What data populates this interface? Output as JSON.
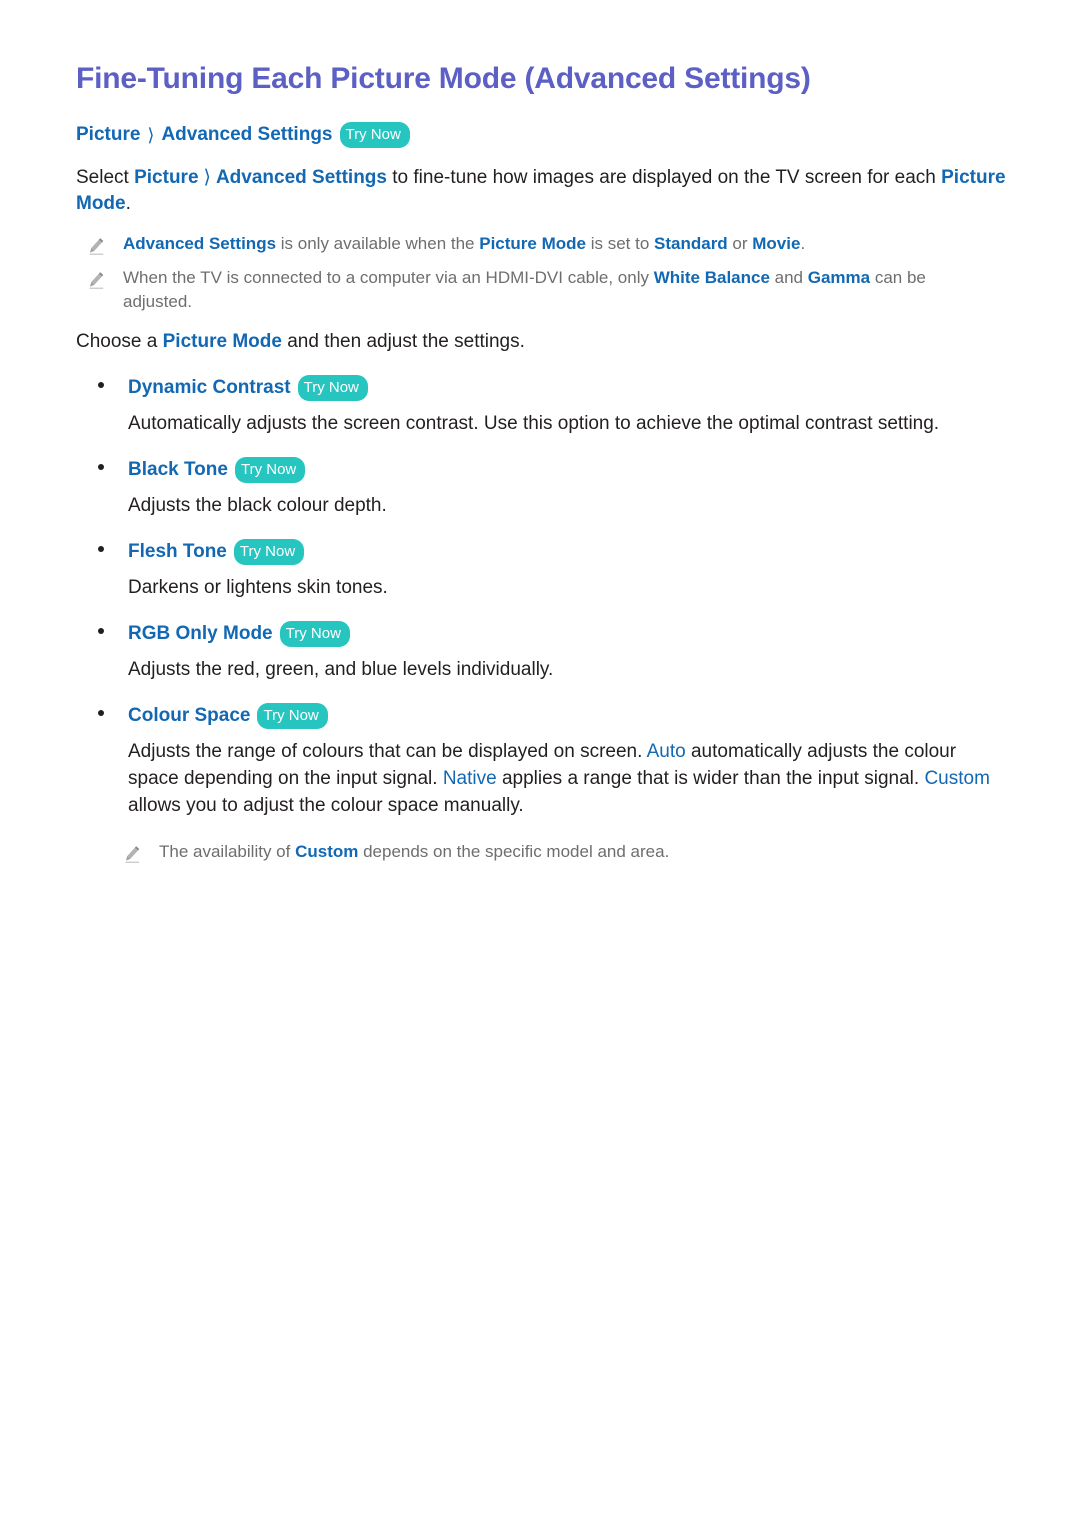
{
  "document": {
    "title": "Fine-Tuning Each Picture Mode (Advanced Settings)"
  },
  "labels": {
    "try_now": "Try Now",
    "caret": "❯"
  },
  "colors": {
    "heading": "#5C5FC4",
    "link_blue": "#1268B3",
    "badge_teal": "#27C5C0",
    "body_text": "#231F20",
    "note_text": "#6D6E70"
  },
  "path": {
    "segment_1": "Picture",
    "segment_2": "Advanced Settings"
  },
  "intro": {
    "lead": "Select ",
    "link_1": "Picture",
    "link_2": "Advanced Settings",
    "middle": " to fine-tune how images are displayed on the TV screen for each ",
    "link_3": "Picture Mode",
    "end": "."
  },
  "notes_top": [
    {
      "icon": "pencil-icon",
      "part_1": "Advanced Settings",
      "part_2": " is only available when the ",
      "part_3": "Picture Mode",
      "part_4": " is set to ",
      "part_5": "Standard",
      "part_6": " or ",
      "part_7": "Movie",
      "part_8": "."
    },
    {
      "icon": "pencil-icon",
      "part_1": "When the TV is connected to a computer via an HDMI-DVI cable, only ",
      "part_2": "White Balance",
      "part_3": " and ",
      "part_4": "Gamma",
      "part_5": " can be adjusted."
    }
  ],
  "choose_line": {
    "part_1": "Choose a ",
    "part_2": "Picture Mode",
    "part_3": " and then adjust the settings."
  },
  "options": [
    {
      "label": "Dynamic Contrast",
      "try_now": "Try Now",
      "description": "Automatically adjusts the screen contrast. Use this option to achieve the optimal contrast setting."
    },
    {
      "label": "Black Tone",
      "try_now": "Try Now",
      "description": "Adjusts the black colour depth."
    },
    {
      "label": "Flesh Tone",
      "try_now": "Try Now",
      "description": "Darkens or lightens skin tones."
    },
    {
      "label": "RGB Only Mode",
      "try_now": "Try Now",
      "description": "Adjusts the red, green, and blue levels individually."
    }
  ],
  "colour_space": {
    "label": "Colour Space",
    "try_now": "Try Now",
    "desc_part_1": "Adjusts the range of colours that can be displayed on screen. ",
    "desc_term_1": "Auto",
    "desc_part_2": " automatically adjusts the colour space depending on the input signal. ",
    "desc_term_2": "Native",
    "desc_part_3": " applies a range that is wider than the input signal. ",
    "desc_term_3": "Custom",
    "desc_part_4": " allows you to adjust the colour space manually.",
    "note": {
      "icon": "pencil-icon",
      "part_1": "The availability of ",
      "part_2": "Custom",
      "part_3": " depends on the specific model and area."
    }
  }
}
